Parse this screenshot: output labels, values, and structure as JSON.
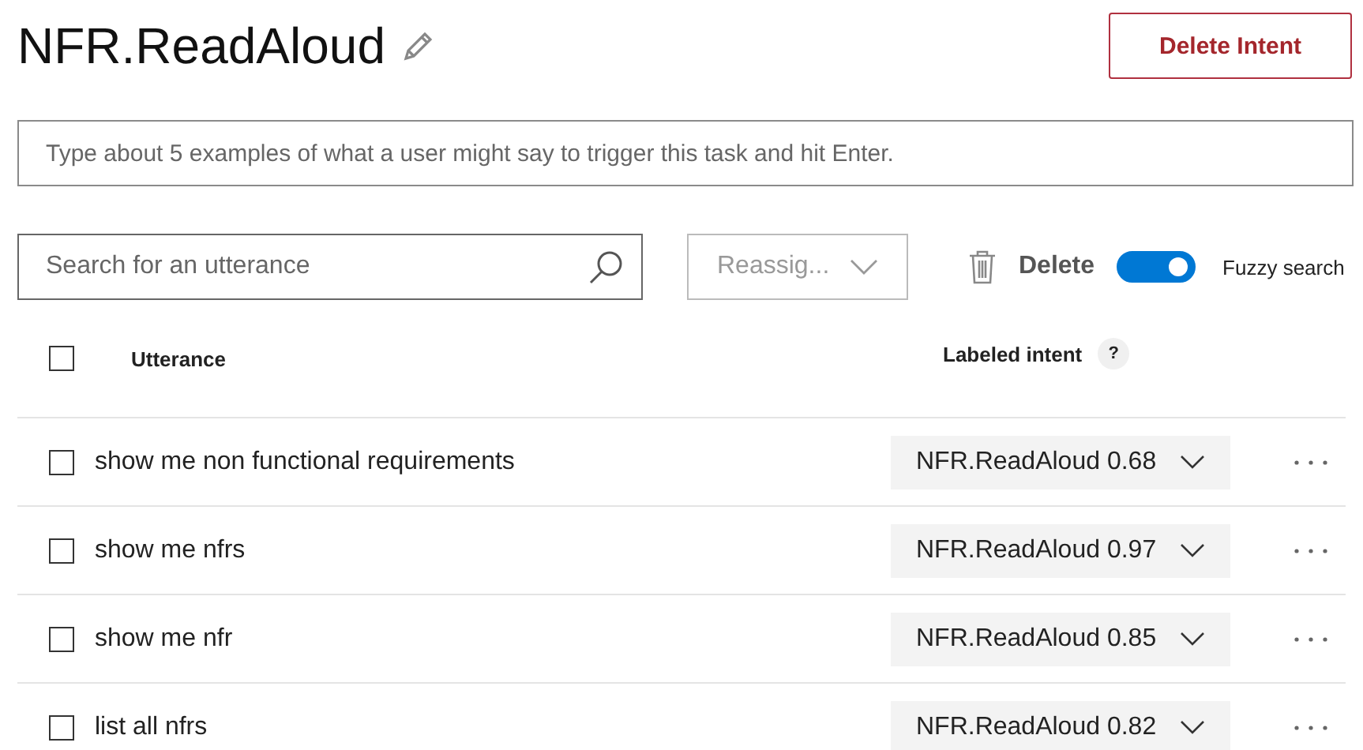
{
  "title": "NFR.ReadAloud",
  "delete_intent_button": "Delete Intent",
  "example_input": {
    "placeholder": "Type about 5 examples of what a user might say to trigger this task and hit Enter."
  },
  "search": {
    "placeholder": "Search for an utterance"
  },
  "reassign_dropdown": {
    "label": "Reassig...",
    "disabled": true
  },
  "delete_button": "Delete",
  "fuzzy_search": {
    "label": "Fuzzy search",
    "on": true
  },
  "table": {
    "select_all_checked": false,
    "columns": [
      "Utterance",
      "Labeled intent"
    ],
    "help_mark": "?",
    "rows": [
      {
        "utterance": "show me non functional requirements",
        "intent": "NFR.ReadAloud 0.68",
        "checked": false
      },
      {
        "utterance": "show me nfrs",
        "intent": "NFR.ReadAloud 0.97",
        "checked": false
      },
      {
        "utterance": "show me nfr",
        "intent": "NFR.ReadAloud 0.85",
        "checked": false
      },
      {
        "utterance": "list all nfrs",
        "intent": "NFR.ReadAloud 0.82",
        "checked": false
      }
    ]
  }
}
